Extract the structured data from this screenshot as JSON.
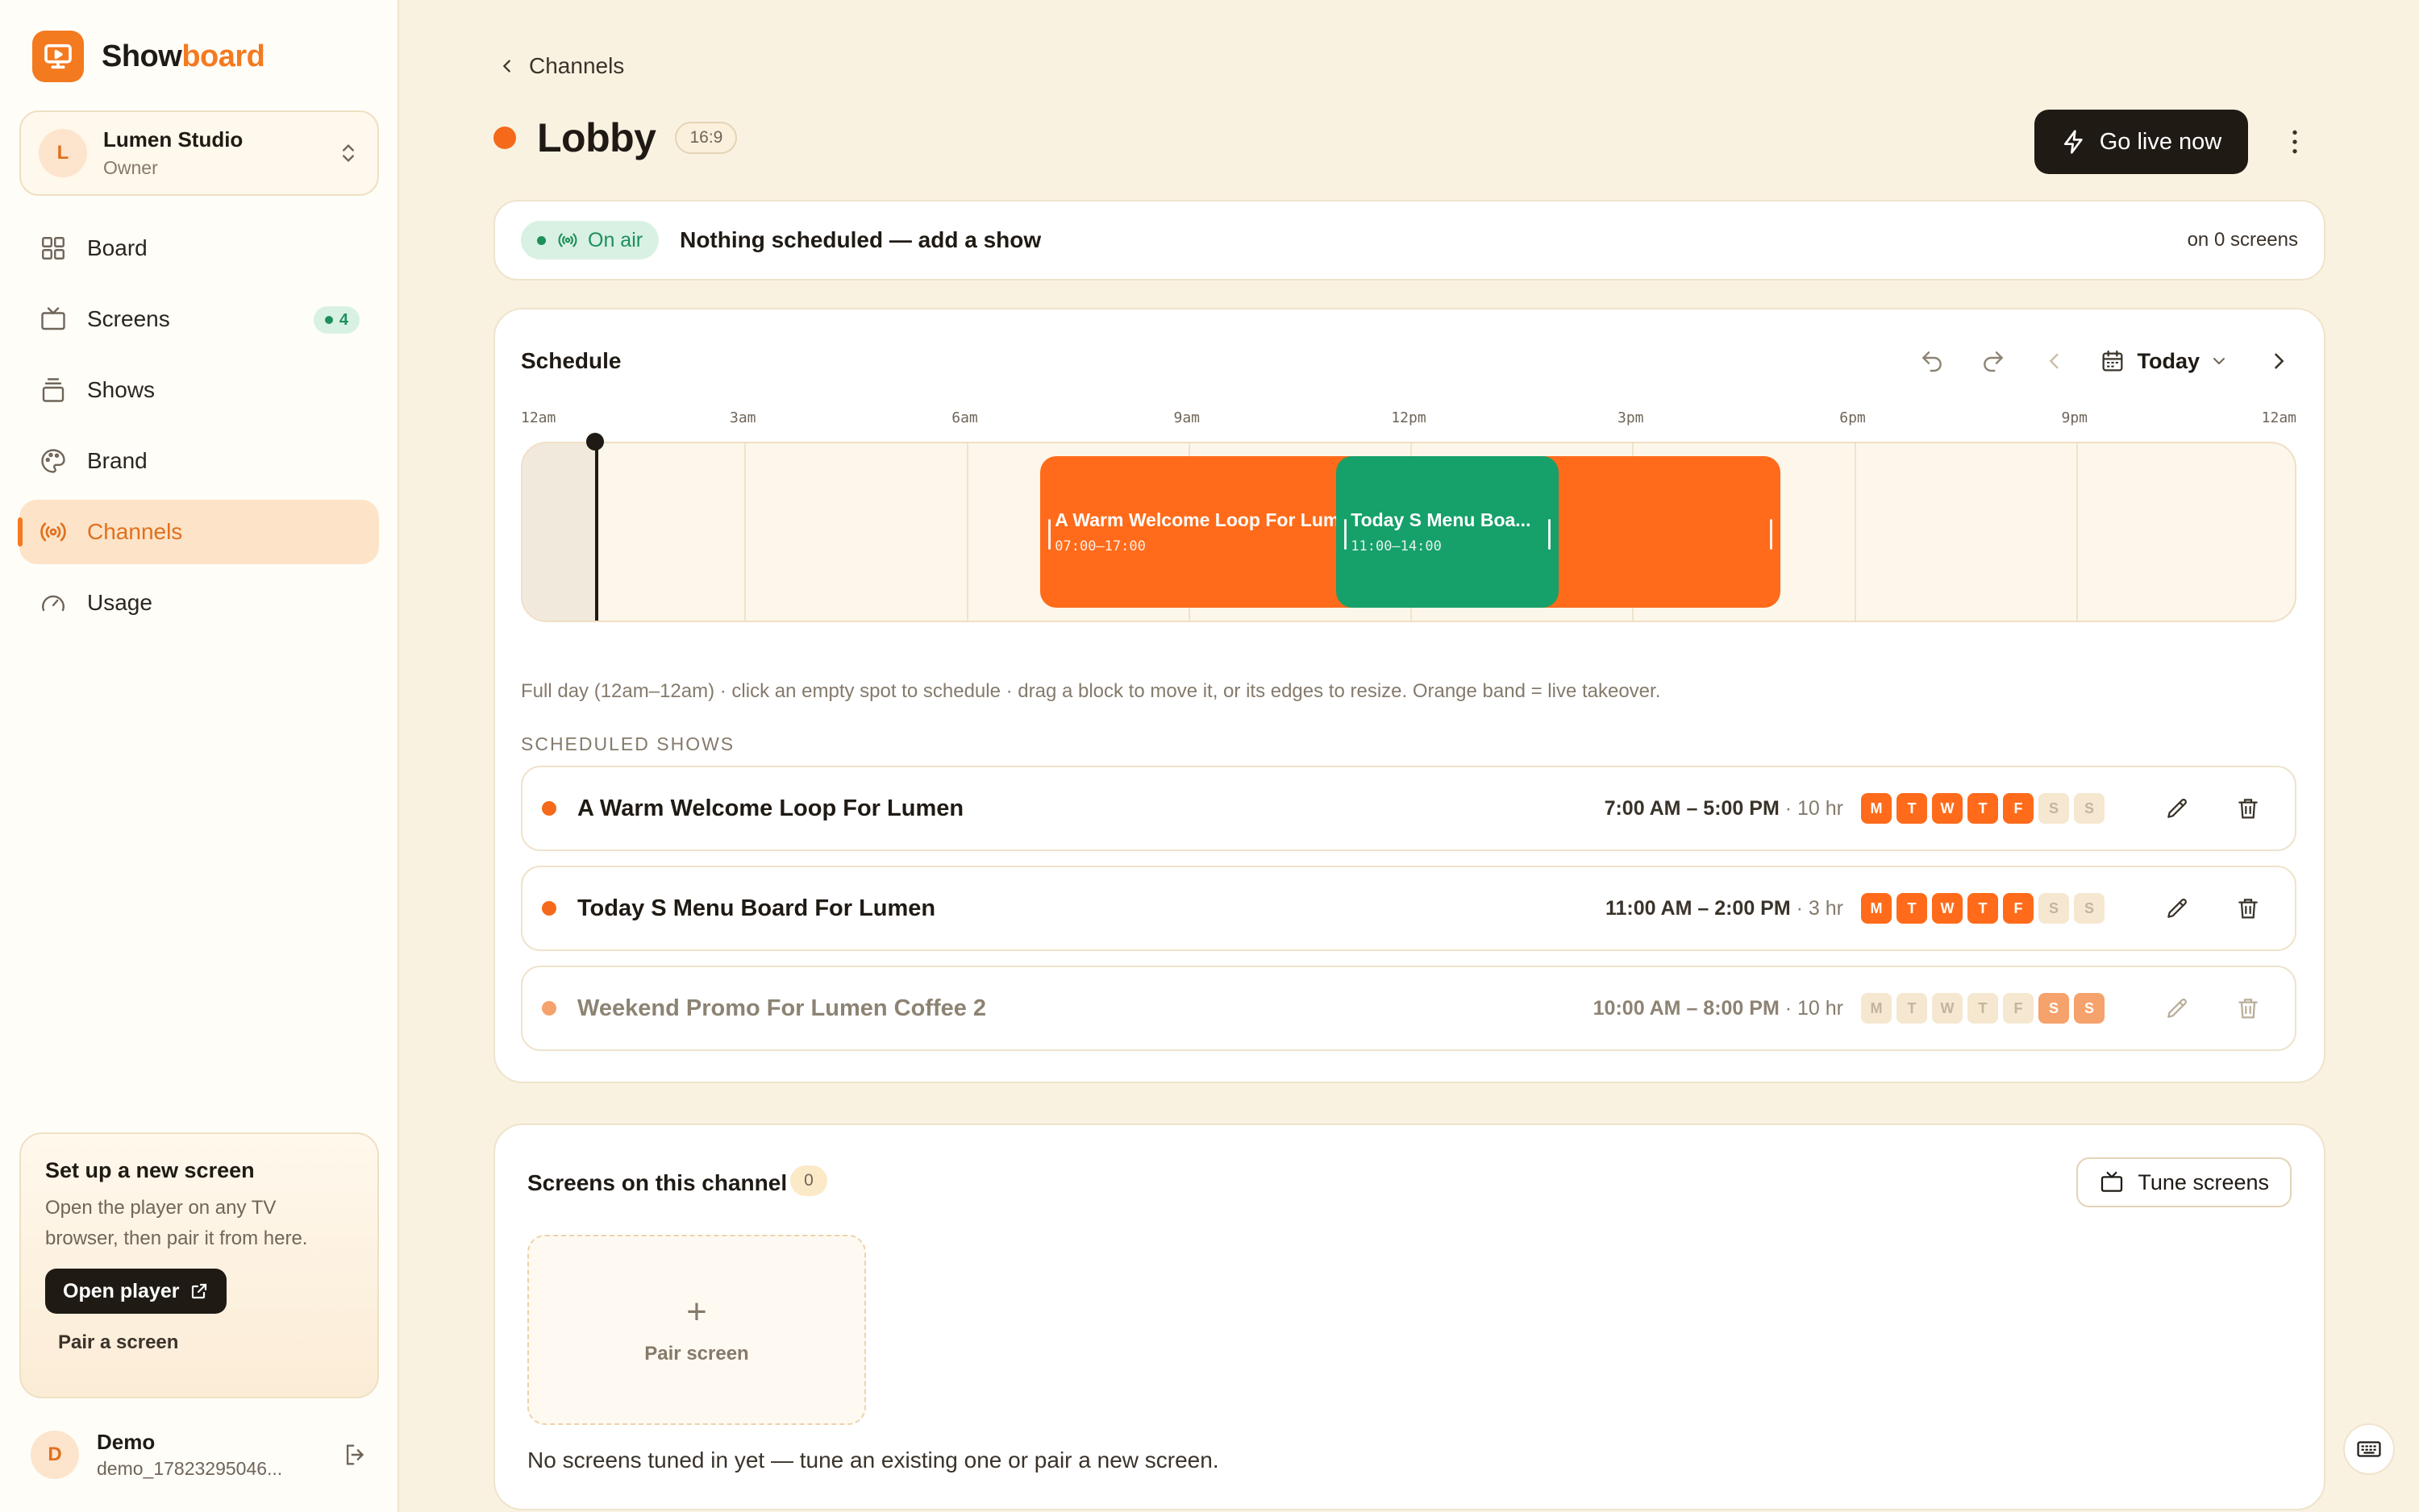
{
  "app": {
    "name_primary": "Show",
    "name_accent": "board",
    "accent_color": "#f47a1f"
  },
  "workspace": {
    "initial": "L",
    "name": "Lumen Studio",
    "role": "Owner"
  },
  "nav": {
    "items": [
      {
        "label": "Board",
        "icon": "grid-icon"
      },
      {
        "label": "Screens",
        "icon": "tv-icon",
        "badge": "4"
      },
      {
        "label": "Shows",
        "icon": "layers-icon"
      },
      {
        "label": "Brand",
        "icon": "palette-icon"
      },
      {
        "label": "Channels",
        "icon": "broadcast-icon",
        "active": true
      },
      {
        "label": "Usage",
        "icon": "gauge-icon"
      }
    ]
  },
  "setup": {
    "title": "Set up a new screen",
    "desc_line1": "Open the player on any TV",
    "desc_line2": "browser, then pair it from here.",
    "open_player": "Open player",
    "pair_link": "Pair a screen"
  },
  "user": {
    "initial": "D",
    "name": "Demo",
    "id": "demo_17823295046..."
  },
  "header": {
    "back_label": "Channels",
    "title": "Lobby",
    "ratio": "16:9",
    "go_live": "Go live now"
  },
  "onair": {
    "status": "On air",
    "message": "Nothing scheduled — add a show",
    "screens": "on 0 screens"
  },
  "schedule": {
    "title": "Schedule",
    "day_label": "Today",
    "hour_labels": [
      "12am",
      "3am",
      "6am",
      "9am",
      "12pm",
      "3pm",
      "6pm",
      "9pm",
      "12am"
    ],
    "now_hour": 1.0,
    "blocks": [
      {
        "name": "A Warm Welcome Loop For Lumen",
        "time": "07:00–17:00",
        "start": 7,
        "end": 17,
        "color": "#ff6b1a"
      },
      {
        "name": "Today S Menu Boa...",
        "time": "11:00–14:00",
        "start": 11,
        "end": 14,
        "color": "#16a06a"
      }
    ],
    "hint": "Full day (12am–12am) · click an empty spot to schedule · drag a block to move it, or its edges to resize. Orange band = live takeover.",
    "section_label": "SCHEDULED SHOWS",
    "shows": [
      {
        "name": "A Warm Welcome Loop For Lumen",
        "time": "7:00 AM – 5:00 PM",
        "duration": "· 10 hr",
        "days": [
          "M",
          "T",
          "W",
          "T",
          "F",
          "S",
          "S"
        ],
        "active": [
          1,
          1,
          1,
          1,
          1,
          0,
          0
        ],
        "muted": false
      },
      {
        "name": "Today S Menu Board For Lumen",
        "time": "11:00 AM – 2:00 PM",
        "duration": "· 3 hr",
        "days": [
          "M",
          "T",
          "W",
          "T",
          "F",
          "S",
          "S"
        ],
        "active": [
          1,
          1,
          1,
          1,
          1,
          0,
          0
        ],
        "muted": false
      },
      {
        "name": "Weekend Promo For Lumen Coffee 2",
        "time": "10:00 AM – 8:00 PM",
        "duration": "· 10 hr",
        "days": [
          "M",
          "T",
          "W",
          "T",
          "F",
          "S",
          "S"
        ],
        "active": [
          0,
          0,
          0,
          0,
          0,
          1,
          1
        ],
        "muted": true
      }
    ]
  },
  "screens_panel": {
    "title": "Screens on this channel",
    "count": "0",
    "tune_button": "Tune screens",
    "pair_label": "Pair screen",
    "empty_message": "No screens tuned in yet — tune an existing one or pair a new screen."
  }
}
